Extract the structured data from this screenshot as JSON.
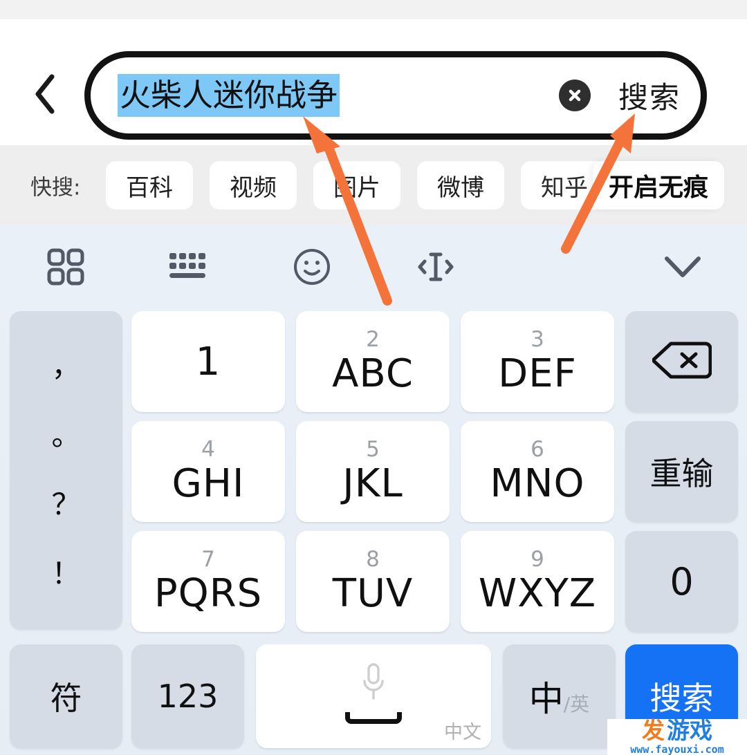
{
  "header": {
    "back_icon": "chevron-left-icon",
    "search_value": "火柴人迷你战争",
    "clear_icon": "clear-circle-icon",
    "search_action_label": "搜索"
  },
  "quickbar": {
    "label": "快搜:",
    "chips": [
      {
        "label": "百科"
      },
      {
        "label": "视频"
      },
      {
        "label": "图片"
      },
      {
        "label": "微博"
      },
      {
        "label": "知乎"
      }
    ],
    "incognito_label": "开启无痕"
  },
  "keyboard": {
    "toolbar": [
      {
        "icon": "grid-panel-icon"
      },
      {
        "icon": "keyboard-icon"
      },
      {
        "icon": "emoji-smiley-icon"
      },
      {
        "icon": "cursor-move-icon"
      },
      {
        "icon": "chevron-down-icon"
      }
    ],
    "punctuation_key": {
      "chars": [
        "，",
        "。",
        "？",
        "！"
      ]
    },
    "keys": [
      {
        "num": "",
        "letters": "1",
        "type": "white"
      },
      {
        "num": "2",
        "letters": "ABC",
        "type": "white"
      },
      {
        "num": "3",
        "letters": "DEF",
        "type": "white"
      },
      {
        "num": "4",
        "letters": "GHI",
        "type": "white"
      },
      {
        "num": "5",
        "letters": "JKL",
        "type": "white"
      },
      {
        "num": "6",
        "letters": "MNO",
        "type": "white"
      },
      {
        "num": "7",
        "letters": "PQRS",
        "type": "white"
      },
      {
        "num": "8",
        "letters": "TUV",
        "type": "white"
      },
      {
        "num": "9",
        "letters": "WXYZ",
        "type": "white"
      }
    ],
    "backspace_icon": "backspace-icon",
    "redo_label": "重输",
    "zero_label": "0",
    "symbol_label": "符",
    "numeric_label": "123",
    "space": {
      "mic_icon": "microphone-icon",
      "hint": "中文"
    },
    "lang_toggle": {
      "active": "中",
      "separator": "/",
      "inactive": "英"
    },
    "enter_label": "搜索"
  },
  "annotations": {
    "arrow_color": "#F4733A",
    "arrows": [
      {
        "name": "arrow-to-search-input"
      },
      {
        "name": "arrow-to-search-button"
      }
    ]
  },
  "watermark": {
    "logo_first": "发",
    "logo_rest": "游戏",
    "url": "www.fayouxi.com"
  },
  "colors": {
    "accent_blue": "#1672F5",
    "selection_blue": "#7EC8F7",
    "keyboard_bg": "#EAF0F7",
    "gray_key": "#D5DCE6",
    "quickbar_bg": "#EEEEEE",
    "arrow_orange": "#F4733A"
  }
}
